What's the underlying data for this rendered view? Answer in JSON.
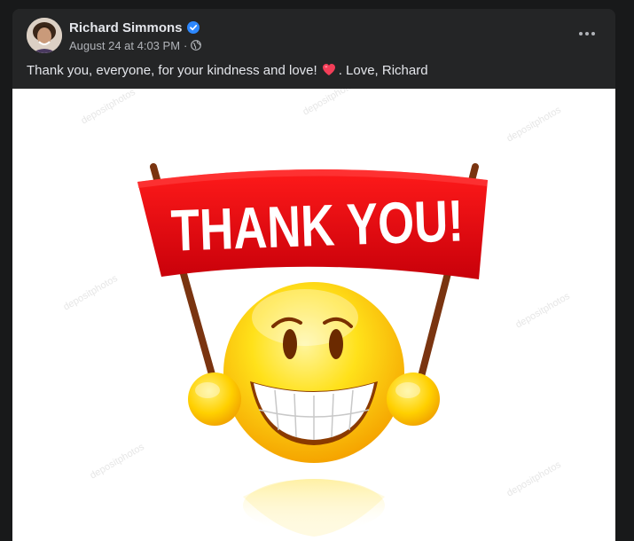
{
  "post": {
    "author": "Richard Simmons",
    "verified_icon": "verified-badge-icon",
    "timestamp": "August 24 at 4:03 PM",
    "separator": "·",
    "audience_icon": "globe-icon",
    "text_before": "Thank you, everyone, for your kindness and love!",
    "emoji": "red-heart",
    "text_after": ". Love, Richard",
    "more_icon": "more-options-icon",
    "image": {
      "banner_text": "THANK YOU!",
      "watermark": "depositphotos",
      "banner_color": "#e0000b",
      "face_color": "#ffd600"
    }
  },
  "colors": {
    "background": "#18191a",
    "card": "#242526",
    "primary_text": "#e4e6eb",
    "secondary_text": "#b0b3b8",
    "verified": "#2d88ff"
  }
}
